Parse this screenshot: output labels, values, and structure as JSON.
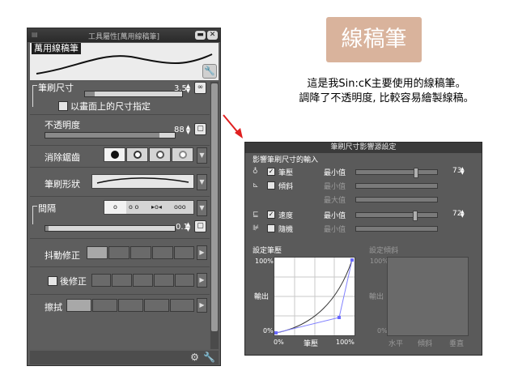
{
  "panel": {
    "window_title": "工具屬性[萬用線稿筆]",
    "preview_label": "萬用線稿筆",
    "brush_size": {
      "label": "筆刷尺寸",
      "value": "3.5",
      "fill": 0.1
    },
    "canvas_size_option": {
      "label": "以畫面上的尺寸指定",
      "checked": false
    },
    "opacity": {
      "label": "不透明度",
      "value": "88",
      "fill": 0.88
    },
    "antialias": {
      "label": "消除鋸齒",
      "selected_index": 0
    },
    "brush_shape": {
      "label": "筆刷形狀"
    },
    "spacing": {
      "label": "間隔",
      "value": "0.1",
      "fill": 0.05
    },
    "stabilization": {
      "label": "抖動修正"
    },
    "post_correction": {
      "label": "後修正",
      "checked": false
    },
    "smudge": {
      "label": "擦拭"
    }
  },
  "caption": {
    "badge": "線稿筆",
    "line1": "這是我Sin:cK主要使用的線稿筆。",
    "line2": "調降了不透明度, 比較容易繪製線稿。"
  },
  "dialog": {
    "title": "筆刷尺寸影響源設定",
    "section_title": "影響筆刷尺寸的輸入",
    "rows": [
      {
        "name": "筆壓",
        "checked": true,
        "enabled": true,
        "min_label": "最小值",
        "value": "73",
        "knob": 0.73
      },
      {
        "name": "傾斜",
        "checked": false,
        "enabled": true,
        "min_label": "最小值",
        "dim": true
      },
      {
        "name": "",
        "checked": false,
        "enabled": false,
        "min_label": "最大值",
        "dim": true
      },
      {
        "name": "速度",
        "checked": true,
        "enabled": true,
        "min_label": "最小值",
        "value": "72",
        "knob": 0.72
      },
      {
        "name": "隨機",
        "checked": false,
        "enabled": true,
        "min_label": "最小值",
        "dim": true
      }
    ],
    "pressure_graph": {
      "title": "設定筆壓",
      "y_top": "100%",
      "y_mid": "輸出",
      "y_bottom": "0%",
      "x_left": "0%",
      "x_mid": "筆壓",
      "x_right": "100%"
    },
    "tilt_graph": {
      "title": "設定傾斜",
      "y_top": "100%",
      "y_mid": "輸出",
      "y_bottom": "0%",
      "x_left": "水平",
      "x_mid": "傾斜",
      "x_right": "垂直"
    }
  },
  "colors": {
    "accent_badge": "#d9b39c",
    "arrow": "#e02020",
    "panel_bg": "#5c5c5c"
  }
}
